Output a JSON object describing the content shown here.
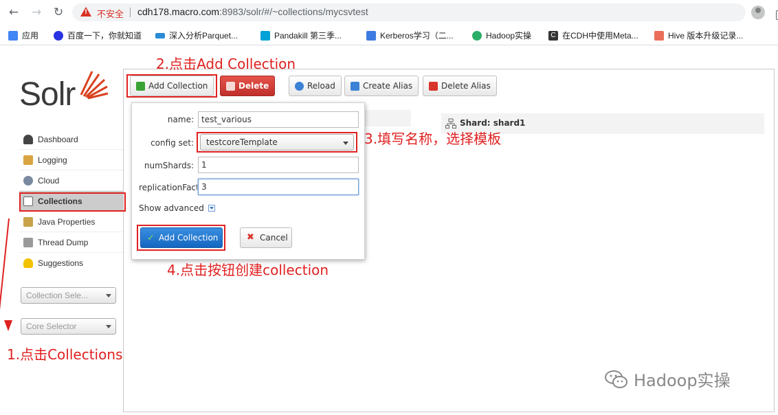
{
  "browser": {
    "security_label": "不安全",
    "url_host": "cdh178.macro.com",
    "url_rest": ":8983/solr/#/~collections/mycsvtest"
  },
  "bookmarks": [
    {
      "label": "应用",
      "icon": "apps-grid-icon",
      "color": "#4285f4"
    },
    {
      "label": "百度一下，你就知道",
      "icon": "baidu-paw-icon",
      "color": "#2932e1"
    },
    {
      "label": "深入分析Parquet...",
      "icon": "infoq-icon",
      "color": "#2a8bd6"
    },
    {
      "label": "Pandakill 第三季...",
      "icon": "bilibili-tv-icon",
      "color": "#00a1d6"
    },
    {
      "label": "Kerberos学习（二...",
      "icon": "feather-icon",
      "color": "#3e7be0"
    },
    {
      "label": "Hadoop实操",
      "icon": "wechat-icon",
      "color": "#2aae67"
    },
    {
      "label": "在CDH中使用Meta...",
      "icon": "c-logo-icon",
      "color": "#333333"
    },
    {
      "label": "Hive 版本升级记录...",
      "icon": "jianshu-icon",
      "color": "#ea6f5a"
    }
  ],
  "solr": {
    "logo_text": "Solr",
    "nav": [
      {
        "label": "Dashboard",
        "icon": "dashboard-icon",
        "color": "#444444",
        "active": false
      },
      {
        "label": "Logging",
        "icon": "logging-icon",
        "color": "#d9a441",
        "active": false
      },
      {
        "label": "Cloud",
        "icon": "cloud-icon",
        "color": "#7a8aa0",
        "active": false
      },
      {
        "label": "Collections",
        "icon": "collections-icon",
        "color": "#9aa4b0",
        "active": true
      },
      {
        "label": "Java Properties",
        "icon": "java-icon",
        "color": "#c9a24a",
        "active": false
      },
      {
        "label": "Thread Dump",
        "icon": "thread-dump-icon",
        "color": "#9a9a9a",
        "active": false
      },
      {
        "label": "Suggestions",
        "icon": "lightbulb-icon",
        "color": "#f2c200",
        "active": false
      }
    ],
    "collection_selector": "Collection Sele...",
    "core_selector": "Core Selector"
  },
  "toolbar": {
    "add_collection": "Add Collection",
    "delete": "Delete",
    "reload": "Reload",
    "create_alias": "Create Alias",
    "delete_alias": "Delete Alias"
  },
  "shard": {
    "label": "Shard: shard1"
  },
  "dialog": {
    "name_label": "name:",
    "name_value": "test_various",
    "config_label": "config set:",
    "config_value": "testcoreTemplate",
    "numshards_label": "numShards:",
    "numshards_value": "1",
    "replication_label": "replicationFact",
    "replication_value": "3",
    "show_advanced": "Show advanced",
    "submit": "Add Collection",
    "cancel": "Cancel"
  },
  "annotations": {
    "step1": "1.点击Collections",
    "step2": "2.点击Add Collection",
    "step3": "3.填写名称，选择模板",
    "step4": "4.点击按钮创建collection",
    "color": "#e02020"
  },
  "watermark": "Hadoop实操"
}
